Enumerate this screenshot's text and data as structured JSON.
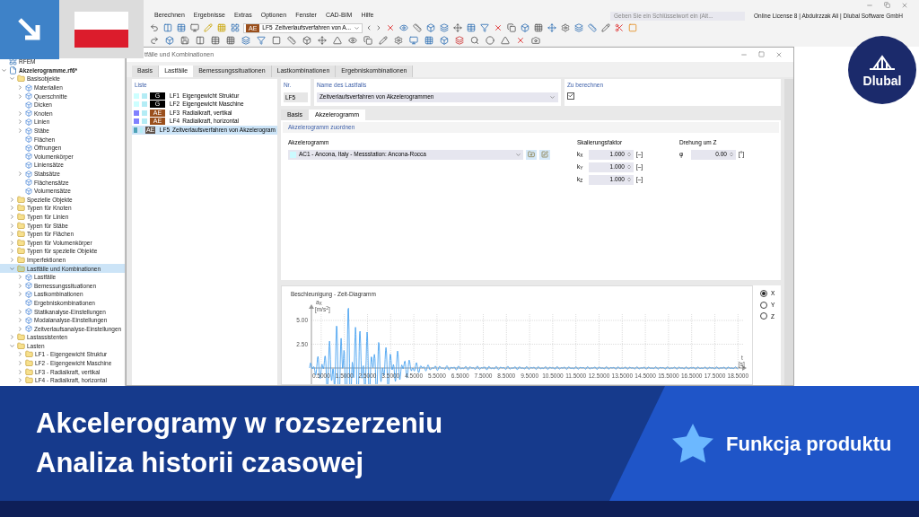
{
  "menu": [
    "Berechnen",
    "Ergebnisse",
    "Extras",
    "Optionen",
    "Fenster",
    "CAD-BIM",
    "Hilfe"
  ],
  "search": {
    "placeholder": "Geben Sie ein Schlüsselwort ein (Alt..."
  },
  "license": "Online License 8 | Abdulrzzak Ali | Dlubal Software GmbH",
  "toolbar": {
    "loadcase": {
      "badge": "AE",
      "id": "LF5",
      "name": "Zeitverlaufsverfahren von A..."
    }
  },
  "navigator": {
    "items": [
      {
        "label": "RFEM",
        "kind": "app",
        "selected": false
      },
      {
        "label": "Akzelerogramme.rf6*",
        "kind": "file",
        "expanded": true,
        "selected": false,
        "children": [
          {
            "label": "Basisobjekte",
            "kind": "folder",
            "expanded": true,
            "selected": false,
            "children": [
              {
                "label": "Materialien",
                "kind": "object",
                "expanded": false,
                "selected": false
              },
              {
                "label": "Querschnitte",
                "kind": "object",
                "expanded": false,
                "selected": false
              },
              {
                "label": "Dicken",
                "kind": "object",
                "selected": false
              },
              {
                "label": "Knoten",
                "kind": "object",
                "expanded": false,
                "selected": false
              },
              {
                "label": "Linien",
                "kind": "object",
                "expanded": false,
                "selected": false
              },
              {
                "label": "Stäbe",
                "kind": "object",
                "expanded": false,
                "selected": false
              },
              {
                "label": "Flächen",
                "kind": "object",
                "selected": false
              },
              {
                "label": "Öffnungen",
                "kind": "object",
                "selected": false
              },
              {
                "label": "Volumenkörper",
                "kind": "object",
                "selected": false
              },
              {
                "label": "Liniensätze",
                "kind": "object",
                "selected": false
              },
              {
                "label": "Stabsätze",
                "kind": "object",
                "expanded": false,
                "selected": false
              },
              {
                "label": "Flächensätze",
                "kind": "object",
                "selected": false
              },
              {
                "label": "Volumensätze",
                "kind": "object",
                "selected": false
              }
            ]
          },
          {
            "label": "Spezielle Objekte",
            "kind": "folder",
            "expanded": false,
            "selected": false
          },
          {
            "label": "Typen für Knoten",
            "kind": "folder",
            "expanded": false,
            "selected": false
          },
          {
            "label": "Typen für Linien",
            "kind": "folder",
            "expanded": false,
            "selected": false
          },
          {
            "label": "Typen für Stäbe",
            "kind": "folder",
            "expanded": false,
            "selected": false
          },
          {
            "label": "Typen für Flächen",
            "kind": "folder",
            "expanded": false,
            "selected": false
          },
          {
            "label": "Typen für Volumenkörper",
            "kind": "folder",
            "expanded": false,
            "selected": false
          },
          {
            "label": "Typen für spezielle Objekte",
            "kind": "folder",
            "expanded": false,
            "selected": false
          },
          {
            "label": "Imperfektionen",
            "kind": "folder",
            "expanded": false,
            "selected": false
          },
          {
            "label": "Lastfälle und Kombinationen",
            "kind": "folder",
            "expanded": true,
            "selected": true,
            "children": [
              {
                "label": "Lastfälle",
                "kind": "object",
                "expanded": false,
                "selected": false
              },
              {
                "label": "Bemessungssituationen",
                "kind": "object",
                "expanded": false,
                "selected": false
              },
              {
                "label": "Lastkombinationen",
                "kind": "object",
                "expanded": false,
                "selected": false
              },
              {
                "label": "Ergebniskombinationen",
                "kind": "object",
                "selected": false
              },
              {
                "label": "Statikanalyse-Einstellungen",
                "kind": "object",
                "expanded": false,
                "selected": false
              },
              {
                "label": "Modalanalyse-Einstellungen",
                "kind": "object",
                "expanded": false,
                "selected": false
              },
              {
                "label": "Zeitverlaufsanalyse-Einstellungen",
                "kind": "object",
                "expanded": false,
                "selected": false
              }
            ]
          },
          {
            "label": "Lastassistenten",
            "kind": "folder",
            "expanded": false,
            "selected": false
          },
          {
            "label": "Lasten",
            "kind": "folder",
            "expanded": true,
            "selected": false,
            "children": [
              {
                "label": "LF1 - Eigengewicht Struktur",
                "kind": "folder",
                "expanded": false,
                "selected": false
              },
              {
                "label": "LF2 - Eigengewicht Maschine",
                "kind": "folder",
                "expanded": false,
                "selected": false
              },
              {
                "label": "LF3 - Radialkraft, vertikal",
                "kind": "folder",
                "expanded": false,
                "selected": false
              },
              {
                "label": "LF4 - Radialkraft, horizontal",
                "kind": "folder",
                "expanded": false,
                "selected": false
              }
            ]
          }
        ]
      }
    ]
  },
  "dialog": {
    "title": "tfälle und Kombinationen",
    "tabs": [
      {
        "label": "Basis",
        "selected": false
      },
      {
        "label": "Lastfälle",
        "selected": true
      },
      {
        "label": "Bemessungssituationen",
        "selected": false
      },
      {
        "label": "Lastkombinationen",
        "selected": false
      },
      {
        "label": "Ergebniskombinationen",
        "selected": false
      }
    ],
    "list": {
      "heading": "Liste",
      "items": [
        {
          "color": "#ccffff",
          "badge": {
            "text": "G",
            "color": "#000000"
          },
          "id": "LF1",
          "name": "Eigengewicht Struktur",
          "selected": false
        },
        {
          "color": "#ccffff",
          "badge": {
            "text": "G",
            "color": "#000000"
          },
          "id": "LF2",
          "name": "Eigengewicht Maschine",
          "selected": false
        },
        {
          "color": "#8080ff",
          "badge": {
            "text": "AE",
            "color": "#9a4f1c"
          },
          "id": "LF3",
          "name": "Radialkraft, vertikal",
          "selected": false
        },
        {
          "color": "#8080ff",
          "badge": {
            "text": "AE",
            "color": "#9a4f1c"
          },
          "id": "LF4",
          "name": "Radialkraft, horizontal",
          "selected": false
        },
        {
          "color": "#4fa3b8",
          "badge": {
            "text": "AE",
            "color": "#5e5048"
          },
          "id": "LF5",
          "name": "Zeitverlaufsverfahren von Akzelerogram",
          "selected": true
        }
      ]
    },
    "number": {
      "label": "Nr.",
      "value": "LF5"
    },
    "name": {
      "label": "Name des Lastfalls",
      "value": "Zeitverlaufsverfahren von Akzelerogrammen"
    },
    "calculate": {
      "label": "Zu berechnen",
      "checked": true
    },
    "subtabs": [
      {
        "label": "Basis",
        "selected": false
      },
      {
        "label": "Akzelerogramm",
        "selected": true
      }
    ],
    "section": "Akzelerogramm zuordnen",
    "accelerogram": {
      "label": "Akzelerogramm",
      "value": "AC1 - Ancona, Italy - Messstation: Ancona-Rocca"
    },
    "scaling": {
      "label": "Skalierungsfaktor",
      "rows": [
        {
          "symbol": "k$_{X}$",
          "value": "1.000",
          "unit": "[–]"
        },
        {
          "symbol": "k$_{Y}$",
          "value": "1.000",
          "unit": "[–]"
        },
        {
          "symbol": "k$_{Z}$",
          "value": "1.000",
          "unit": "[–]"
        }
      ]
    },
    "rotation": {
      "label": "Drehung um Z",
      "symbol": "φ",
      "value": "0.00",
      "unit": "[°]"
    },
    "chart": {
      "title": "Beschleunigung - Zeit-Diagramm",
      "y_label": "a$_{X}$",
      "y_unit": "[m/s$^{2}$]",
      "y_ticks": [
        "5.00",
        "2.50"
      ],
      "x_label": "t",
      "x_unit": "[s]",
      "x_ticks": [
        "0.5000",
        "1.5000",
        "2.5000",
        "3.5000",
        "4.5000",
        "5.5000",
        "6.5000",
        "7.5000",
        "8.5000",
        "9.5000",
        "10.5000",
        "11.5000",
        "12.5000",
        "13.5000",
        "14.5000",
        "15.5000",
        "16.5000",
        "17.5000",
        "18.5000"
      ]
    },
    "axes": [
      {
        "label": "X",
        "selected": true
      },
      {
        "label": "Y",
        "selected": false
      },
      {
        "label": "Z",
        "selected": false
      }
    ]
  },
  "logo": {
    "text": "Dlubal"
  },
  "banner": {
    "lines": [
      "Akcelerogramy w rozszerzeniu",
      "Analiza historii czasowej"
    ],
    "tag": "Funkcja produktu"
  }
}
